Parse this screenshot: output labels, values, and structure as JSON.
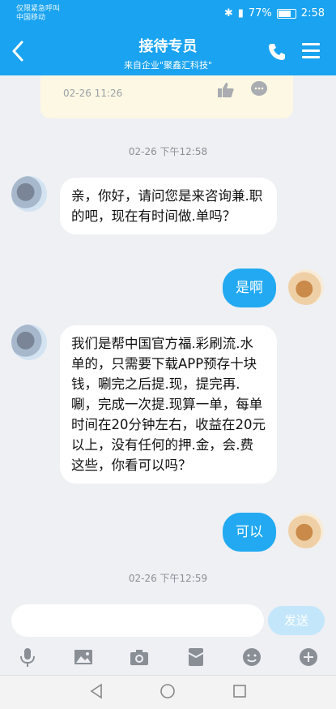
{
  "status_bar": {
    "line1": "仅限紧急呼叫",
    "line2": "中国移动",
    "battery": "77%",
    "time": "2:58"
  },
  "header": {
    "title": "接待专员",
    "subtitle": "来自企业\"聚鑫汇科技\""
  },
  "prev_card": {
    "time": "02-26 11:26"
  },
  "messages": [
    {
      "type": "timestamp",
      "text": "02-26 下午12:58"
    },
    {
      "type": "received",
      "text": "亲，你好，请问您是来咨询兼.职的吧，现在有时间做.单吗？"
    },
    {
      "type": "sent",
      "text": "是啊"
    },
    {
      "type": "received",
      "text": "我们是帮中国官方福.彩刷流.水单的，只需要下载APP预存十块钱，唰完之后提.现，提完再.唰，完成一次提.现算一单，每单时间在20分钟左右，收益在20元以上，没有任何的押.金，会.费这些，你看可以吗？"
    },
    {
      "type": "sent",
      "text": "可以"
    },
    {
      "type": "timestamp",
      "text": "02-26 下午12:59"
    }
  ],
  "input": {
    "placeholder": "",
    "send_label": "发送"
  },
  "colors": {
    "header": "#1aa3f0",
    "sent_bubble": "#22a9f2",
    "card": "#fdf8e3"
  }
}
